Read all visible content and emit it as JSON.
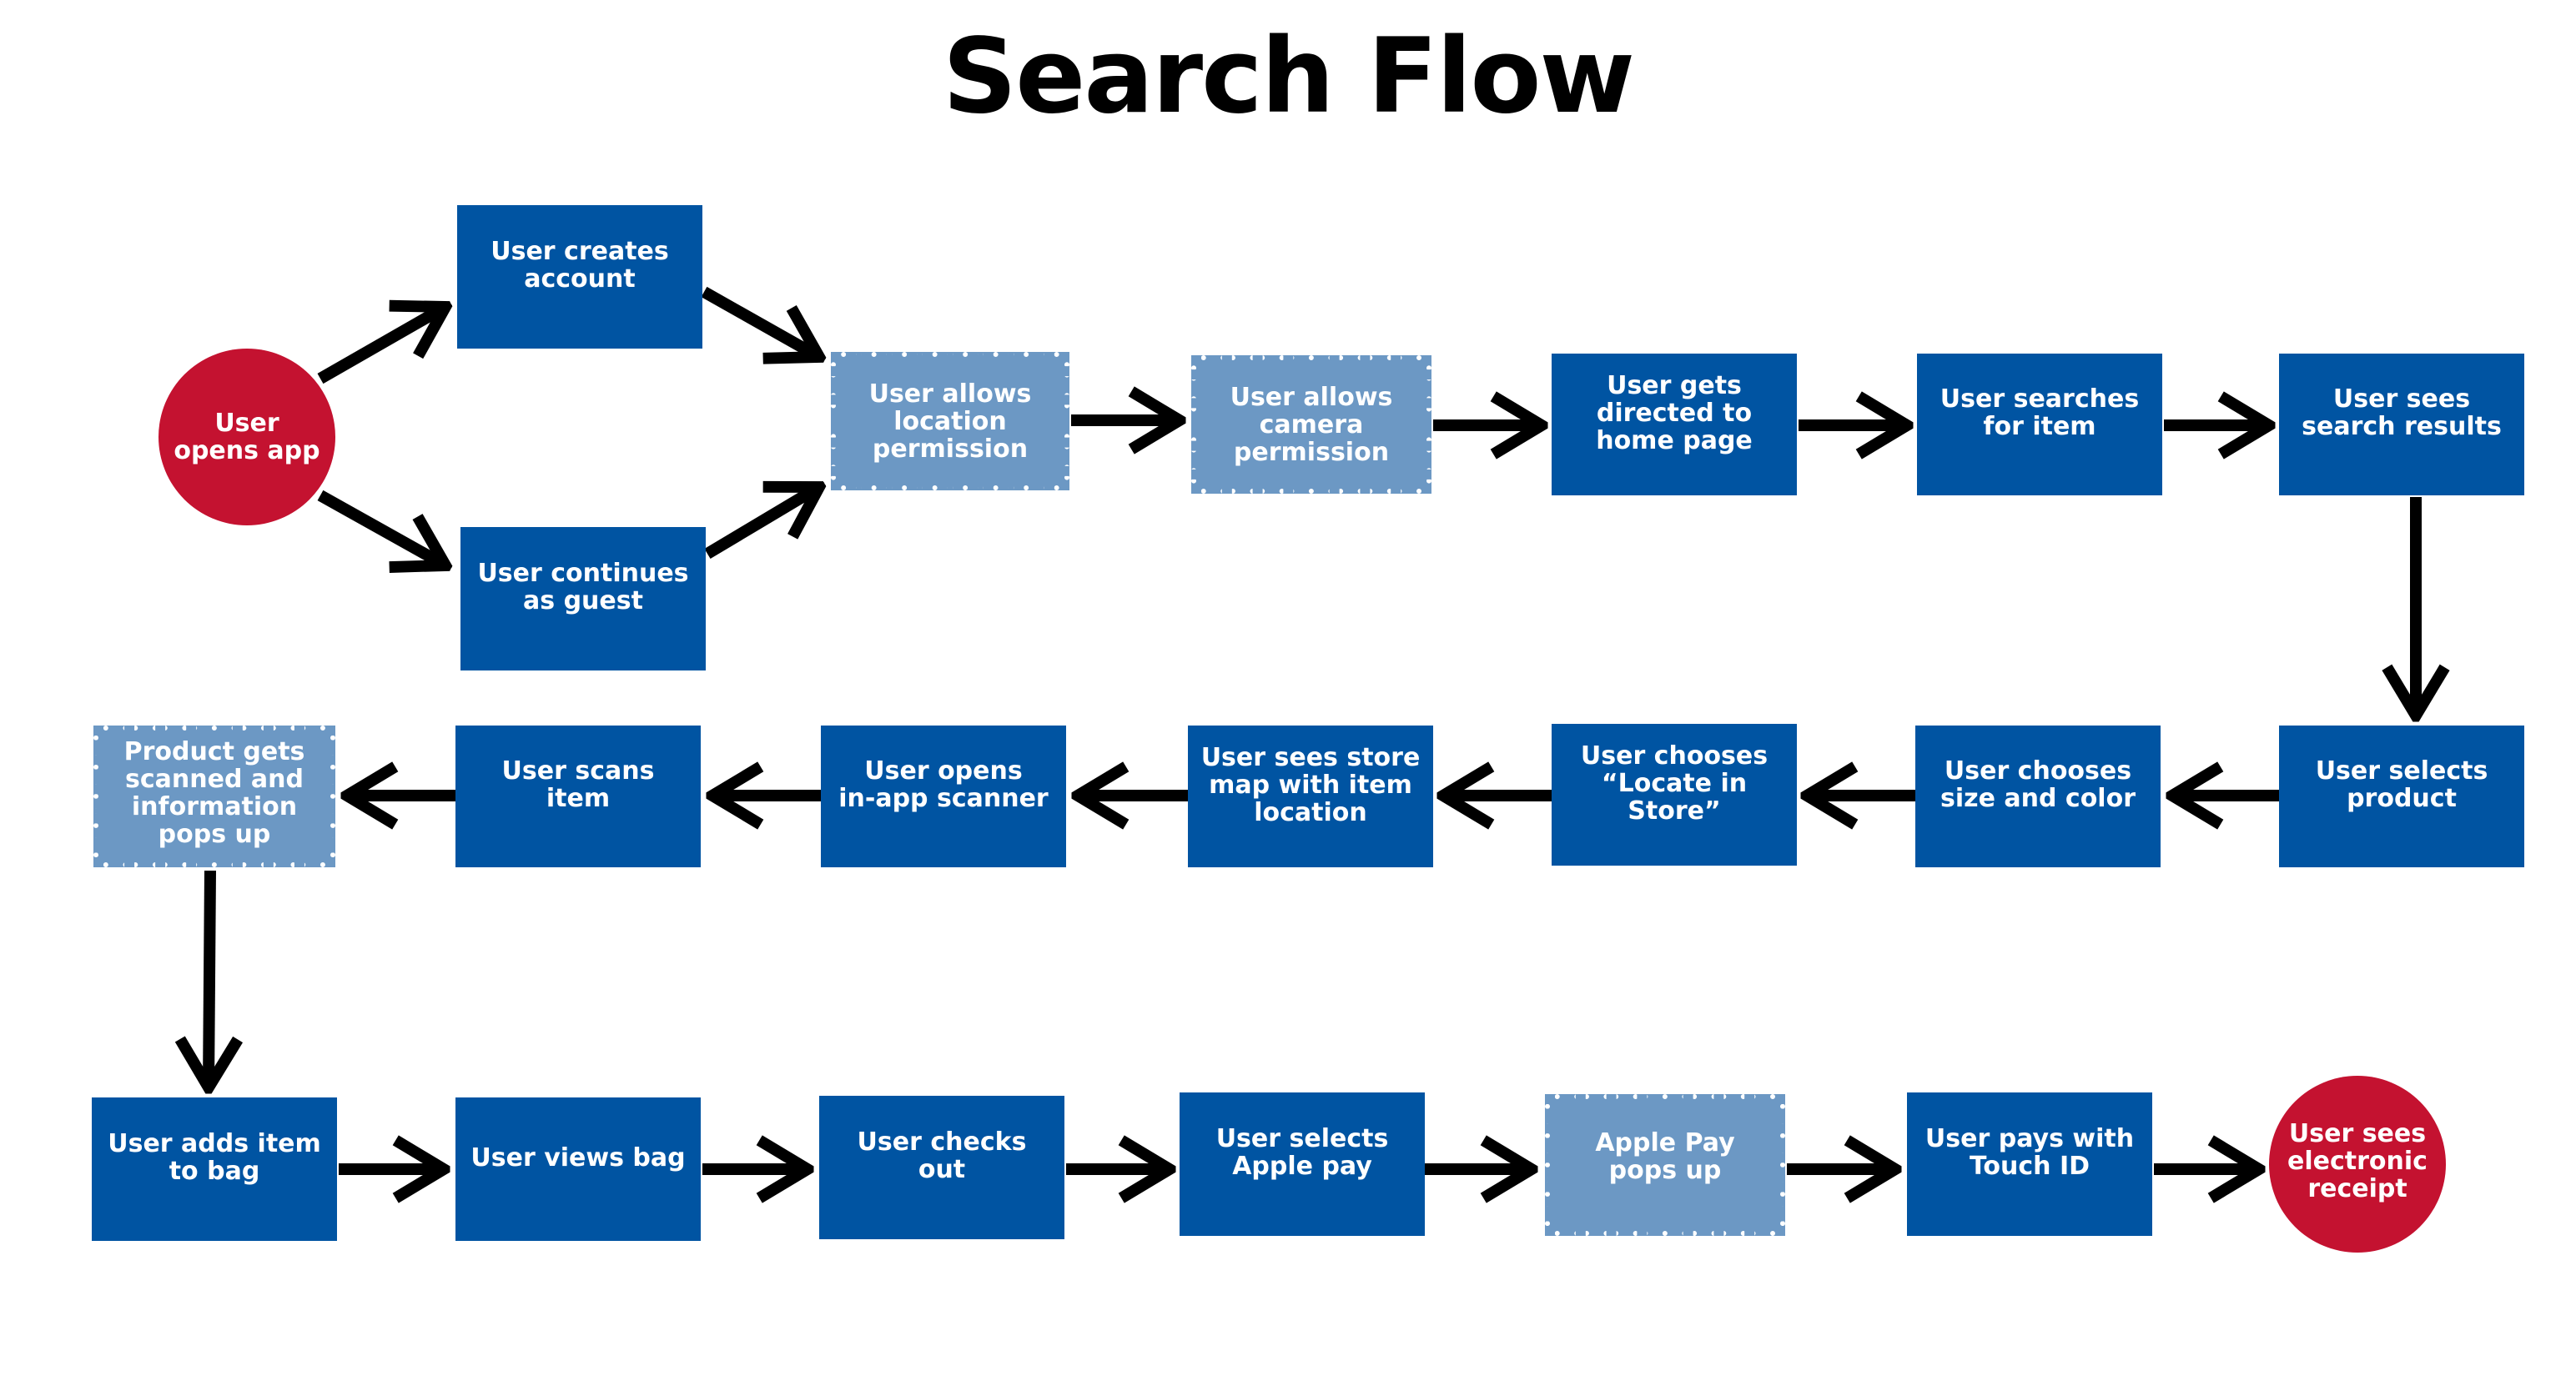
{
  "title": "Search Flow",
  "colors": {
    "primary_step": "#0054A2",
    "system_step": "#6C98C4",
    "terminal": "#C41230",
    "arrow": "#000000"
  },
  "nodes": {
    "start": "User\nopens app",
    "create_account": "User creates\naccount",
    "continue_guest": "User continues\nas guest",
    "allow_location": "User allows\nlocation\npermission",
    "allow_camera": "User allows\ncamera\npermission",
    "home_page": "User gets\ndirected to\nhome page",
    "search_item": "User searches\nfor item",
    "search_results": "User sees\nsearch results",
    "select_product": "User selects\nproduct",
    "size_color": "User chooses\nsize and color",
    "locate_in_store": "User chooses\n“Locate in Store”",
    "store_map": "User sees store\nmap with item\nlocation",
    "open_scanner": "User opens\nin-app scanner",
    "scan_item": "User scans item",
    "product_scanned": "Product gets\nscanned and\ninformation\npops up",
    "add_to_bag": "User adds item\nto bag",
    "view_bag": "User views bag",
    "check_out": "User checks out",
    "select_apple_pay": "User selects\nApple pay",
    "apple_pay_popup": "Apple Pay\npops up",
    "touch_id": "User pays with\nTouch ID",
    "receipt": "User sees\nelectronic\nreceipt"
  },
  "edges": [
    [
      "start",
      "create_account"
    ],
    [
      "start",
      "continue_guest"
    ],
    [
      "create_account",
      "allow_location"
    ],
    [
      "continue_guest",
      "allow_location"
    ],
    [
      "allow_location",
      "allow_camera"
    ],
    [
      "allow_camera",
      "home_page"
    ],
    [
      "home_page",
      "search_item"
    ],
    [
      "search_item",
      "search_results"
    ],
    [
      "search_results",
      "select_product"
    ],
    [
      "select_product",
      "size_color"
    ],
    [
      "size_color",
      "locate_in_store"
    ],
    [
      "locate_in_store",
      "store_map"
    ],
    [
      "store_map",
      "open_scanner"
    ],
    [
      "open_scanner",
      "scan_item"
    ],
    [
      "scan_item",
      "product_scanned"
    ],
    [
      "product_scanned",
      "add_to_bag"
    ],
    [
      "add_to_bag",
      "view_bag"
    ],
    [
      "view_bag",
      "check_out"
    ],
    [
      "check_out",
      "select_apple_pay"
    ],
    [
      "select_apple_pay",
      "apple_pay_popup"
    ],
    [
      "apple_pay_popup",
      "touch_id"
    ],
    [
      "touch_id",
      "receipt"
    ]
  ]
}
